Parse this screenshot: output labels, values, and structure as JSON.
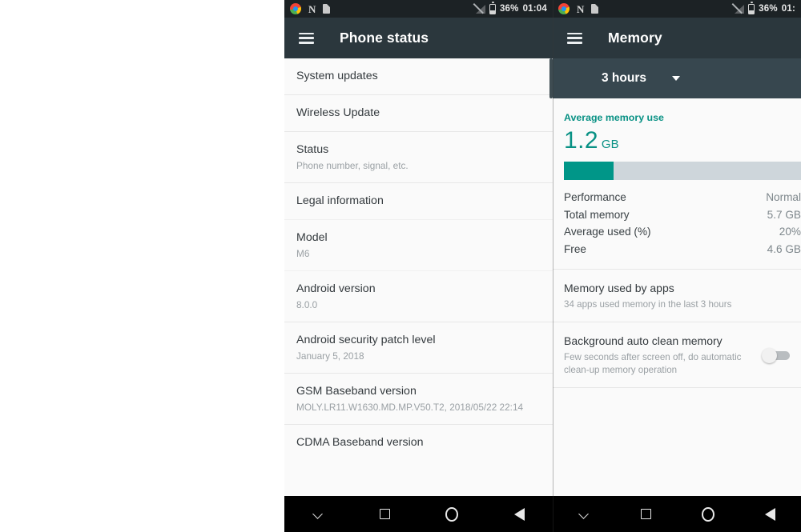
{
  "status_bar": {
    "icons": [
      "chrome-icon",
      "nfc-n-icon",
      "document-icon"
    ],
    "signal_icon": "signal-off-icon",
    "battery_icon": "battery-icon",
    "battery_percent": "36%",
    "time_left": "01:04",
    "time_right": "01:"
  },
  "left_panel": {
    "toolbar": {
      "menu_icon": "hamburger-menu-icon",
      "title": "Phone status"
    },
    "items": [
      {
        "title": "System updates",
        "sub": ""
      },
      {
        "title": "Wireless Update",
        "sub": ""
      },
      {
        "title": "Status",
        "sub": "Phone number, signal, etc."
      },
      {
        "title": "Legal information",
        "sub": ""
      },
      {
        "title": "Model",
        "sub": "M6"
      },
      {
        "title": "Android version",
        "sub": "8.0.0"
      },
      {
        "title": "Android security patch level",
        "sub": "January 5, 2018"
      },
      {
        "title": "GSM Baseband version",
        "sub": "MOLY.LR11.W1630.MD.MP.V50.T2, 2018/05/22 22:14"
      },
      {
        "title": "CDMA Baseband version",
        "sub": ""
      }
    ]
  },
  "right_panel": {
    "toolbar": {
      "menu_icon": "hamburger-menu-icon",
      "title": "Memory"
    },
    "time_range": {
      "label": "3 hours",
      "caret_icon": "chevron-down-icon"
    },
    "average_memory": {
      "label": "Average memory use",
      "value": "1.2",
      "unit": "GB",
      "bar_percent": 20,
      "bar_color": "#009688",
      "track_color": "#ced6db",
      "accent_color": "#089184"
    },
    "stats": [
      {
        "label": "Performance",
        "value": "Normal"
      },
      {
        "label": "Total memory",
        "value": "5.7 GB"
      },
      {
        "label": "Average used (%)",
        "value": "20%"
      },
      {
        "label": "Free",
        "value": "4.6 GB"
      }
    ],
    "apps_section": {
      "title": "Memory used by apps",
      "sub": "34 apps used memory in the last 3 hours"
    },
    "auto_clean": {
      "title": "Background auto clean memory",
      "sub": "Few seconds after screen off, do automatic clean-up memory operation",
      "toggle_state": "off"
    }
  },
  "nav_bar": {
    "buttons": [
      "chevron-down-icon",
      "recents-square-icon",
      "home-circle-icon",
      "back-triangle-icon"
    ]
  }
}
